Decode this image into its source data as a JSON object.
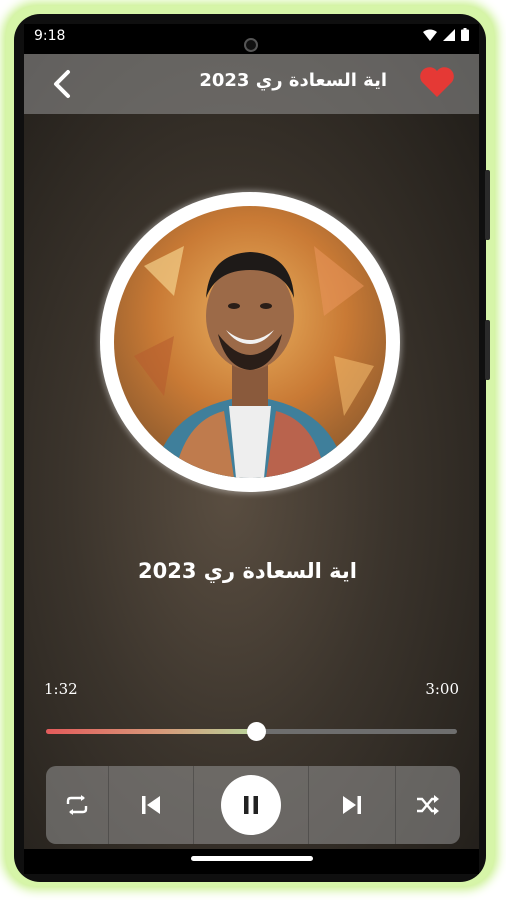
{
  "status_bar": {
    "time": "9:18",
    "icons": [
      "wifi-icon",
      "signal-icon",
      "battery-icon"
    ]
  },
  "header": {
    "title": "اية السعادة ري 2023",
    "back_icon": "chevron-left-icon",
    "favorite_icon": "heart-icon",
    "favorite_color": "#e53935"
  },
  "player": {
    "song_title": "اية السعادة ري 2023",
    "current_time": "1:32",
    "duration": "3:00",
    "progress_fraction": 0.51,
    "progress_colors": [
      "#e45b5b",
      "#b8d59b"
    ]
  },
  "controls": {
    "items": [
      "repeat-icon",
      "skip-previous-icon",
      "pause-icon",
      "skip-next-icon",
      "shuffle-icon"
    ]
  },
  "colors": {
    "glow": "#c8f08c",
    "accent_red": "#e53935",
    "overlay": "#969696"
  }
}
